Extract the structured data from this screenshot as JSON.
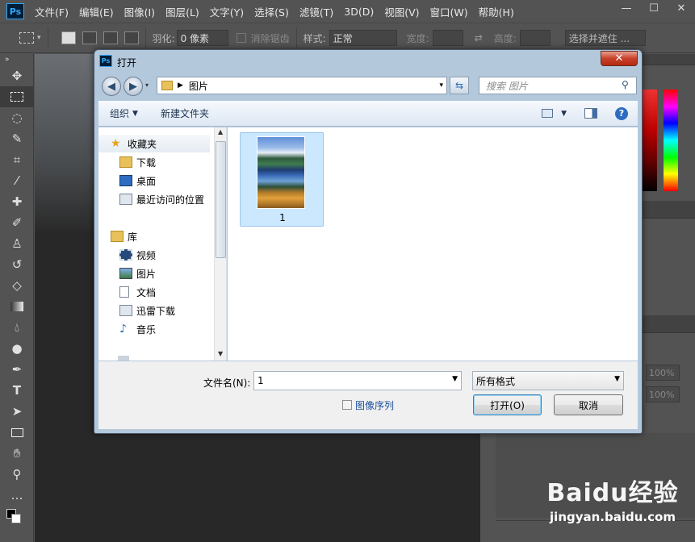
{
  "app": {
    "logo": "Ps",
    "menu": [
      "文件(F)",
      "编辑(E)",
      "图像(I)",
      "图层(L)",
      "文字(Y)",
      "选择(S)",
      "滤镜(T)",
      "3D(D)",
      "视图(V)",
      "窗口(W)",
      "帮助(H)"
    ],
    "window_controls": [
      "—",
      "☐",
      "✕"
    ]
  },
  "options_bar": {
    "feather_label": "羽化:",
    "feather_value": "0 像素",
    "antialias_label": "消除锯齿",
    "style_label": "样式:",
    "style_value": "正常",
    "width_label": "宽度:",
    "height_label": "高度:",
    "select_mask_label": "选择并遮住 ..."
  },
  "dialog": {
    "title": "打开",
    "address_path": "图片",
    "search_placeholder": "搜索 图片",
    "organize_label": "组织",
    "new_folder_label": "新建文件夹",
    "nav": {
      "favorites": "收藏夹",
      "favorites_items": [
        "下载",
        "桌面",
        "最近访问的位置"
      ],
      "libraries": "库",
      "library_items": [
        "视频",
        "图片",
        "文档",
        "迅雷下载",
        "音乐"
      ]
    },
    "file": {
      "name": "1"
    },
    "filename_label": "文件名(N):",
    "filename_value": "1",
    "filetype_value": "所有格式",
    "image_sequence_label": "图像序列",
    "open_button": "打开(O)",
    "cancel_button": "取消"
  },
  "right_panel": {
    "pct1": "100%",
    "pct2": "100%"
  },
  "watermark": {
    "brand": "Baidu经验",
    "url": "jingyan.baidu.com"
  },
  "colors": {
    "ps_bg": "#535353",
    "canvas": "#282828",
    "dialog_frame": "#b4c8dc",
    "selection": "#cce8ff"
  }
}
